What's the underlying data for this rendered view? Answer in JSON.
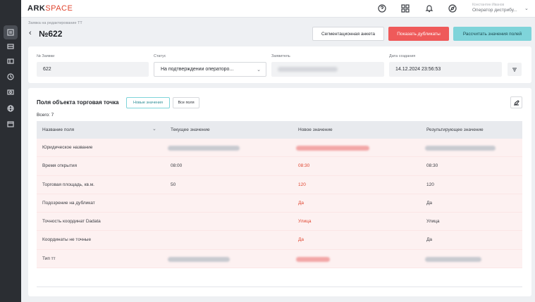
{
  "app": {
    "logo_main": "ARK",
    "logo_light": "SPACE"
  },
  "sidebar": {
    "icons": [
      "requests-icon",
      "inbox-icon",
      "folder-icon",
      "history-icon",
      "users-icon",
      "globe-icon",
      "calendar-icon"
    ]
  },
  "topbar": {
    "user_name": "Константин Иванов",
    "user_role": "Оператор дистрибу...",
    "icons": [
      "help-icon",
      "grid-icon",
      "bell-icon",
      "compass-icon",
      "chevron-down-icon"
    ]
  },
  "header": {
    "breadcrumb": "Заявка на редактирование ТТ",
    "title": "№622",
    "buttons": {
      "segment": "Сегментационная анкета",
      "duplicates": "Показать дубликаты",
      "calculate": "Рассчитать значения полей"
    }
  },
  "info": {
    "request_number_label": "№ Заявки",
    "request_number": "622",
    "status_label": "Статус",
    "status": "На подтверждении операторо...",
    "applicant_label": "Заявитель",
    "created_label": "Дата создания",
    "created": "14.12.2024 23:56:53"
  },
  "fields_section": {
    "title": "Поля объекта торговая точка",
    "toggle_new": "Новые значения",
    "toggle_all": "Все поля",
    "total": "Всего: 7",
    "columns": [
      "Название поля",
      "Текущее значение",
      "Новое значение",
      "Результирующее значение"
    ],
    "rows": [
      {
        "name": "Юридическое название",
        "current": "",
        "new": "",
        "result": ""
      },
      {
        "name": "Время открытия",
        "current": "08:00",
        "new": "08:30",
        "result": "08:30"
      },
      {
        "name": "Торговая площадь, кв.м.",
        "current": "50",
        "new": "120",
        "result": "120"
      },
      {
        "name": "Подозрение на дубликат",
        "current": "",
        "new": "Да",
        "result": "Да"
      },
      {
        "name": "Точность координат Dadata",
        "current": "",
        "new": "Улица",
        "result": "Улица"
      },
      {
        "name": "Координаты не точные",
        "current": "",
        "new": "Да",
        "result": "Да"
      },
      {
        "name": "Тип тт",
        "current": "",
        "new": "",
        "result": ""
      }
    ]
  },
  "colors": {
    "accent_red": "#ef5a5a",
    "accent_teal": "#7fd4da",
    "sidebar": "#2b2e33"
  }
}
